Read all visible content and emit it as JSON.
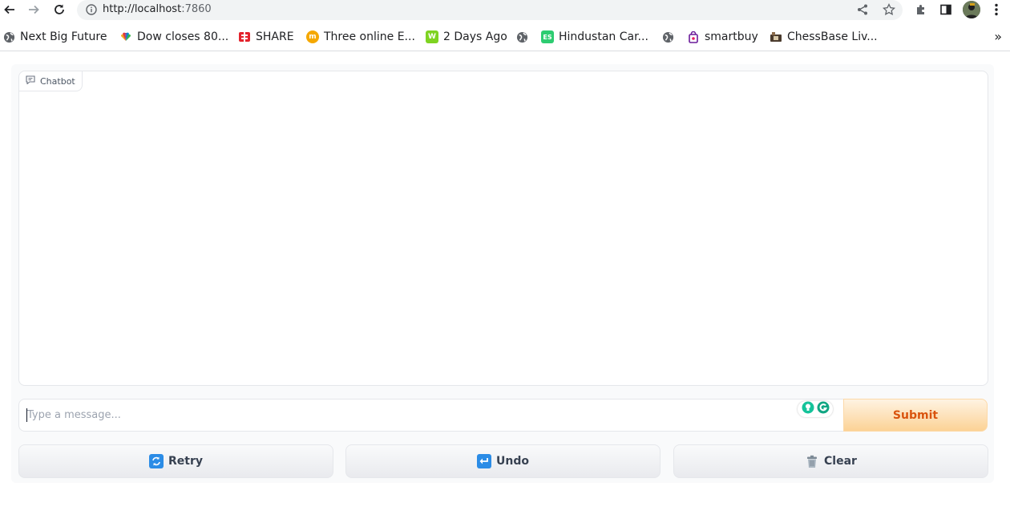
{
  "browser": {
    "url_host": "http://localhost",
    "url_port": ":7860",
    "bookmarks": [
      {
        "label": "Next Big Future",
        "icon": "globe-icon"
      },
      {
        "label": "Dow closes 80...",
        "icon": "nbc-peacock-icon"
      },
      {
        "label": "SHARE",
        "icon": "share-red-icon"
      },
      {
        "label": "Three online E...",
        "icon": "orange-m-icon"
      },
      {
        "label": "2 Days Ago",
        "icon": "green-w-icon"
      },
      {
        "label": "",
        "icon": "globe-icon"
      },
      {
        "label": "Hindustan Car...",
        "icon": "green-es-icon"
      },
      {
        "label": "",
        "icon": "globe-icon"
      },
      {
        "label": "smartbuy",
        "icon": "purple-bag-icon"
      },
      {
        "label": "ChessBase Liv...",
        "icon": "chessbase-icon"
      }
    ],
    "more": "»"
  },
  "chatbot": {
    "label": "Chatbot"
  },
  "input": {
    "placeholder": "Type a message..."
  },
  "buttons": {
    "submit": "Submit",
    "retry": "Retry",
    "undo": "Undo",
    "clear": "Clear"
  },
  "colors": {
    "submit_text": "#d9530e",
    "submit_bg": "#fcd295",
    "button_bg": "#e9eaee",
    "app_bg": "#f9fafb"
  }
}
